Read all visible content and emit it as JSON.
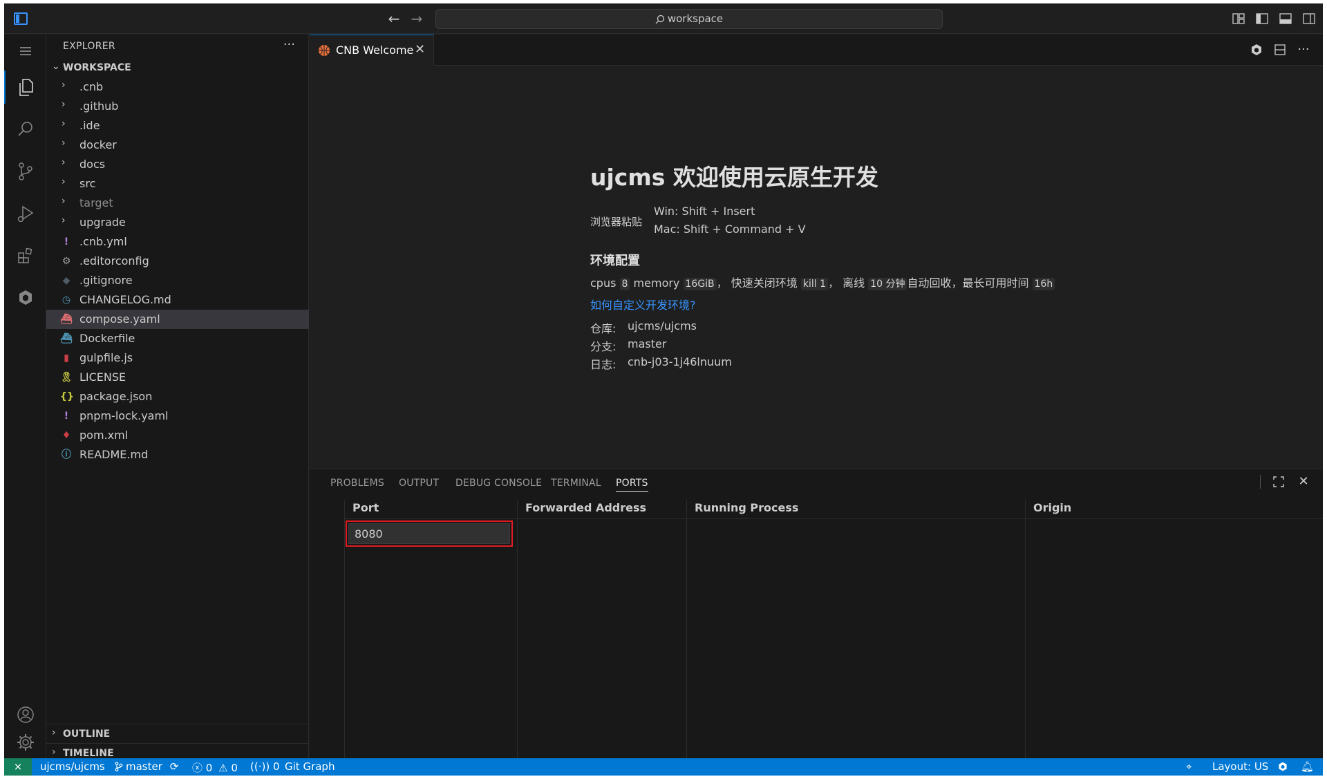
{
  "titlebar": {
    "search_text": "workspace"
  },
  "explorer": {
    "title": "EXPLORER",
    "more": "···",
    "workspace_label": "WORKSPACE",
    "folders": [
      ".cnb",
      ".github",
      ".ide",
      "docker",
      "docs",
      "src",
      "target",
      "upgrade"
    ],
    "files": [
      ".cnb.yml",
      ".editorconfig",
      ".gitignore",
      "CHANGELOG.md",
      "compose.yaml",
      "Dockerfile",
      "gulpfile.js",
      "LICENSE",
      "package.json",
      "pnpm-lock.yaml",
      "pom.xml",
      "README.md"
    ],
    "selected": "compose.yaml",
    "outline_label": "OUTLINE",
    "timeline_label": "TIMELINE"
  },
  "editor": {
    "tab_label": "CNB Welcome",
    "welcome": {
      "title": "ujcms 欢迎使用云原生开发",
      "paste_label": "浏览器粘贴",
      "paste_win": "Win: Shift + Insert",
      "paste_mac": "Mac: Shift + Command + V",
      "env_title": "环境配置",
      "cpus_label": "cpus",
      "cpus_value": "8",
      "memory_label": "memory",
      "memory_value": "16GiB",
      "quick_close_label": "，  快速关闭环境",
      "quick_close_cmd": "kill 1",
      "offline_label": "，  离线",
      "offline_value": "10 分钟",
      "recycle_label": "自动回收，最长可用时间",
      "max_time": "16h",
      "customize_link": "如何自定义开发环境?",
      "repo_label": "仓库:",
      "repo_value": "ujcms/ujcms",
      "branch_label": "分支:",
      "branch_value": "master",
      "log_label": "日志:",
      "log_value": "cnb-j03-1j46lnuum"
    }
  },
  "panel": {
    "tabs": [
      "PROBLEMS",
      "OUTPUT",
      "DEBUG CONSOLE",
      "TERMINAL",
      "PORTS"
    ],
    "active_tab": "PORTS",
    "columns": [
      "Port",
      "Forwarded Address",
      "Running Process",
      "Origin"
    ],
    "port_input_value": "8080"
  },
  "statusbar": {
    "repo": "ujcms/ujcms",
    "branch": "master",
    "errors": "0",
    "warnings": "0",
    "ports": "0",
    "git_graph": "Git Graph",
    "layout": "Layout: US"
  },
  "colors": {
    "accent": "#0078d4",
    "remote": "#16825d",
    "highlight": "#e11b22",
    "link": "#3794ff"
  }
}
